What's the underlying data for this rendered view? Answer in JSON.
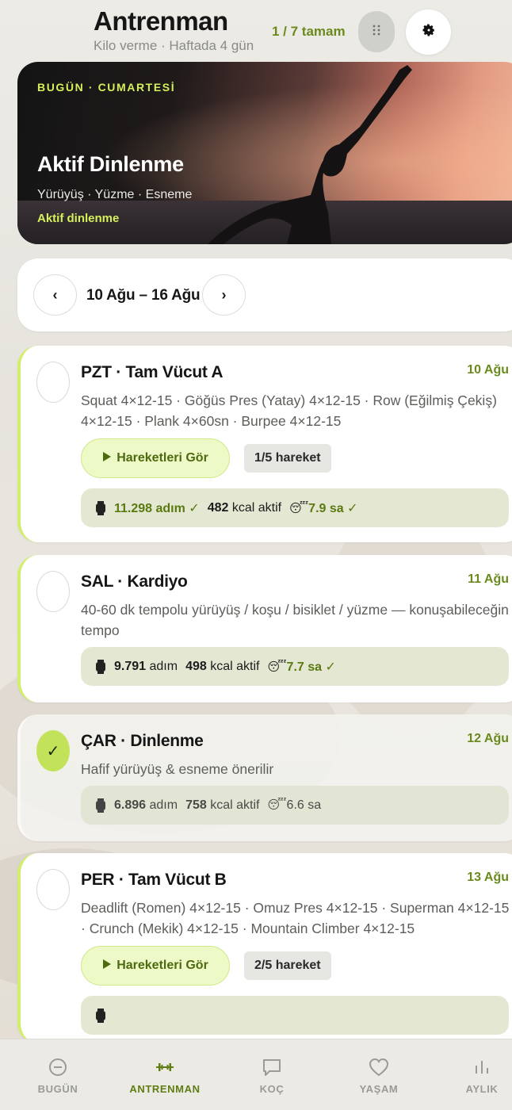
{
  "header": {
    "title": "Antrenman",
    "subtitle": "Kilo verme · Haftada 4 gün",
    "progress": "1 / 7 tamam",
    "grid_icon": "grid-dots-icon",
    "settings_icon": "gear-icon"
  },
  "hero": {
    "day_label": "BUGÜN · CUMARTESİ",
    "title": "Aktif Dinlenme",
    "subtitle": "Yürüyüş · Yüzme · Esneme",
    "tag": "Aktif dinlenme"
  },
  "week": {
    "label": "10 Ağu – 16 Ağu",
    "prev": "‹",
    "next": "›"
  },
  "days": [
    {
      "title": "PZT · Tam Vücut A",
      "date": "10 Ağu",
      "desc": "Squat 4×12-15 · Göğüs Pres (Yatay) 4×12-15 · Row (Eğilmiş Çekiş) 4×12-15 · Plank 4×60sn · Burpee 4×12-15",
      "moves_label": "Hareketleri Gör",
      "moves_count": "1/5 hareket",
      "steps": "11.298 adım ✓",
      "kcal_value": "482",
      "kcal_label": "kcal aktif",
      "sleep": "7.9 sa ✓",
      "done": false
    },
    {
      "title": "SAL · Kardiyo",
      "date": "11 Ağu",
      "desc": "40-60 dk tempolu yürüyüş / koşu / bisiklet / yüzme — konuşabileceğin tempo",
      "steps_value": "9.791",
      "steps_label": "adım",
      "kcal_value": "498",
      "kcal_label": "kcal aktif",
      "sleep": "7.7 sa ✓",
      "done": false
    },
    {
      "title": "ÇAR · Dinlenme",
      "date": "12 Ağu",
      "desc": "Hafif yürüyüş & esneme önerilir",
      "steps_value": "6.896",
      "steps_label": "adım",
      "kcal_value": "758",
      "kcal_label": "kcal aktif",
      "sleep": "6.6 sa",
      "done": true,
      "check_mark": "✓"
    },
    {
      "title": "PER · Tam Vücut B",
      "date": "13 Ağu",
      "desc": "Deadlift (Romen) 4×12-15 · Omuz Pres 4×12-15 · Superman 4×12-15 · Crunch (Mekik) 4×12-15 · Mountain Climber 4×12-15",
      "moves_label": "Hareketleri Gör",
      "moves_count": "2/5 hareket",
      "done": false
    }
  ],
  "nav": [
    {
      "label": "BUGÜN",
      "icon": "minus-circle-icon",
      "active": false
    },
    {
      "label": "ANTRENMAN",
      "icon": "dumbbell-icon",
      "active": true
    },
    {
      "label": "KOÇ",
      "icon": "chat-bubble-icon",
      "active": false
    },
    {
      "label": "YAŞAM",
      "icon": "heart-icon",
      "active": false
    },
    {
      "label": "AYLIK",
      "icon": "bar-chart-icon",
      "active": false
    }
  ],
  "colors": {
    "accent": "#d6ef5a",
    "accent_text": "#6b8a1e",
    "nav_active": "#5e7d12"
  }
}
